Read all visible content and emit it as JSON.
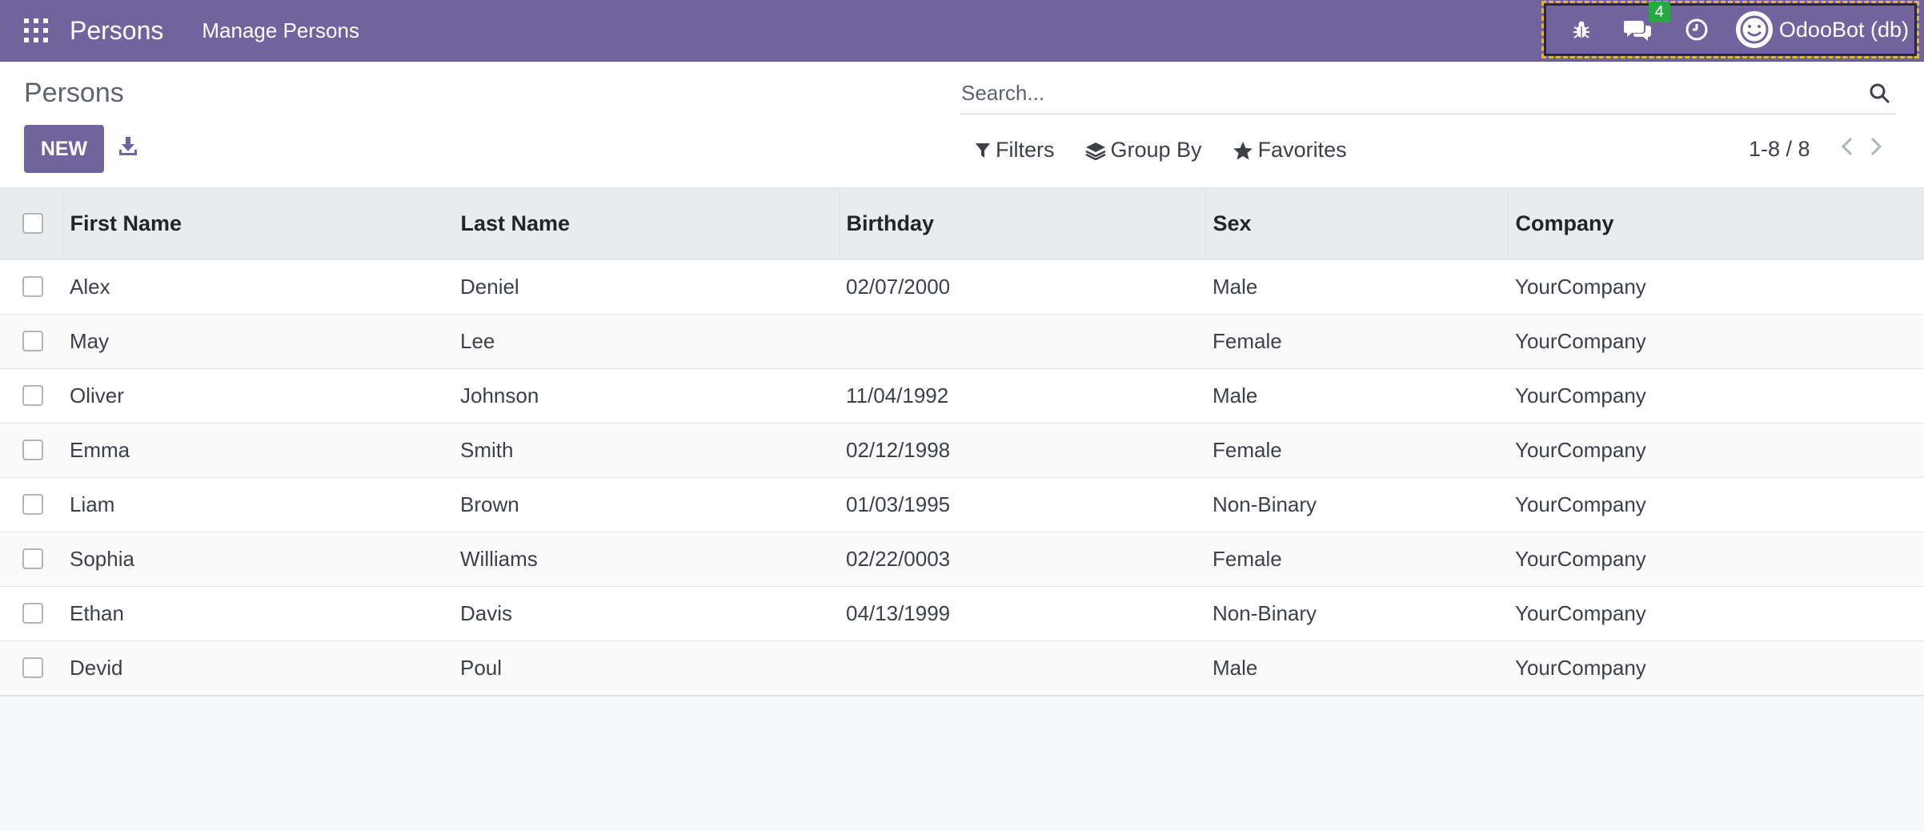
{
  "navbar": {
    "brand": "Persons",
    "menu_item": "Manage Persons",
    "messages_count": "4",
    "user_name": "OdooBot (db)",
    "accent_color": "#71639e"
  },
  "control_panel": {
    "title": "Persons",
    "new_label": "NEW",
    "search_placeholder": "Search...",
    "filters_label": "Filters",
    "group_by_label": "Group By",
    "favorites_label": "Favorites",
    "pager_value": "1-8 / 8"
  },
  "table": {
    "headers": {
      "first_name": "First Name",
      "last_name": "Last Name",
      "birthday": "Birthday",
      "sex": "Sex",
      "company": "Company"
    },
    "rows": [
      {
        "first": "Alex",
        "last": "Deniel",
        "birthday": "02/07/2000",
        "sex": "Male",
        "company": "YourCompany"
      },
      {
        "first": "May",
        "last": "Lee",
        "birthday": "",
        "sex": "Female",
        "company": "YourCompany"
      },
      {
        "first": "Oliver",
        "last": "Johnson",
        "birthday": "11/04/1992",
        "sex": "Male",
        "company": "YourCompany"
      },
      {
        "first": "Emma",
        "last": "Smith",
        "birthday": "02/12/1998",
        "sex": "Female",
        "company": "YourCompany"
      },
      {
        "first": "Liam",
        "last": "Brown",
        "birthday": "01/03/1995",
        "sex": "Non-Binary",
        "company": "YourCompany"
      },
      {
        "first": "Sophia",
        "last": "Williams",
        "birthday": "02/22/0003",
        "sex": "Female",
        "company": "YourCompany"
      },
      {
        "first": "Ethan",
        "last": "Davis",
        "birthday": "04/13/1999",
        "sex": "Non-Binary",
        "company": "YourCompany"
      },
      {
        "first": "Devid",
        "last": "Poul",
        "birthday": "",
        "sex": "Male",
        "company": "YourCompany"
      }
    ]
  }
}
